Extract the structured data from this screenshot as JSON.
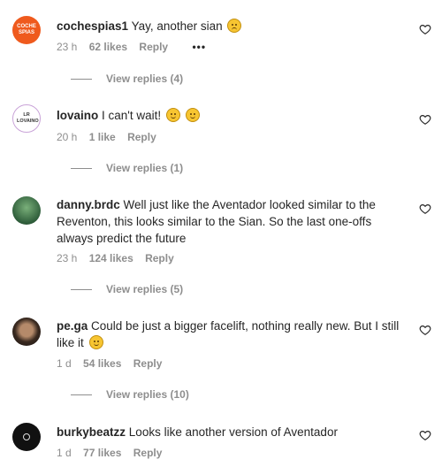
{
  "comments": [
    {
      "username": "cochespias1",
      "text": "Yay, another sian",
      "emoji": "disappointed-face",
      "time": "23 h",
      "likes": "62 likes",
      "reply": "Reply",
      "more": "•••",
      "view_replies": "View replies (4)",
      "avatar_text": "COCHE SPIAS"
    },
    {
      "username": "lovaino",
      "text": "I can't wait!",
      "emoji": "grinning-face",
      "time": "20 h",
      "likes": "1 like",
      "reply": "Reply",
      "view_replies": "View replies (1)",
      "avatar_text": "LR LOVAINO"
    },
    {
      "username": "danny.brdc",
      "text": "Well just like the Aventador looked similar to the Reventon, this looks similar to the Sian. So the last one-offs always predict the future",
      "time": "23 h",
      "likes": "124 likes",
      "reply": "Reply",
      "view_replies": "View replies (5)"
    },
    {
      "username": "pe.ga",
      "text": "Could be just a bigger facelift, nothing really new. But I still like it",
      "emoji": "smiling-face",
      "time": "1 d",
      "likes": "54 likes",
      "reply": "Reply",
      "view_replies": "View replies (10)"
    },
    {
      "username": "burkybeatzz",
      "text": "Looks like another version of Aventador",
      "time": "1 d",
      "likes": "77 likes",
      "reply": "Reply"
    }
  ],
  "colors": {
    "text": "#262626",
    "muted": "#8e8e8e",
    "avatar1": "#ef5a1d",
    "emoji": "#f7c531"
  }
}
